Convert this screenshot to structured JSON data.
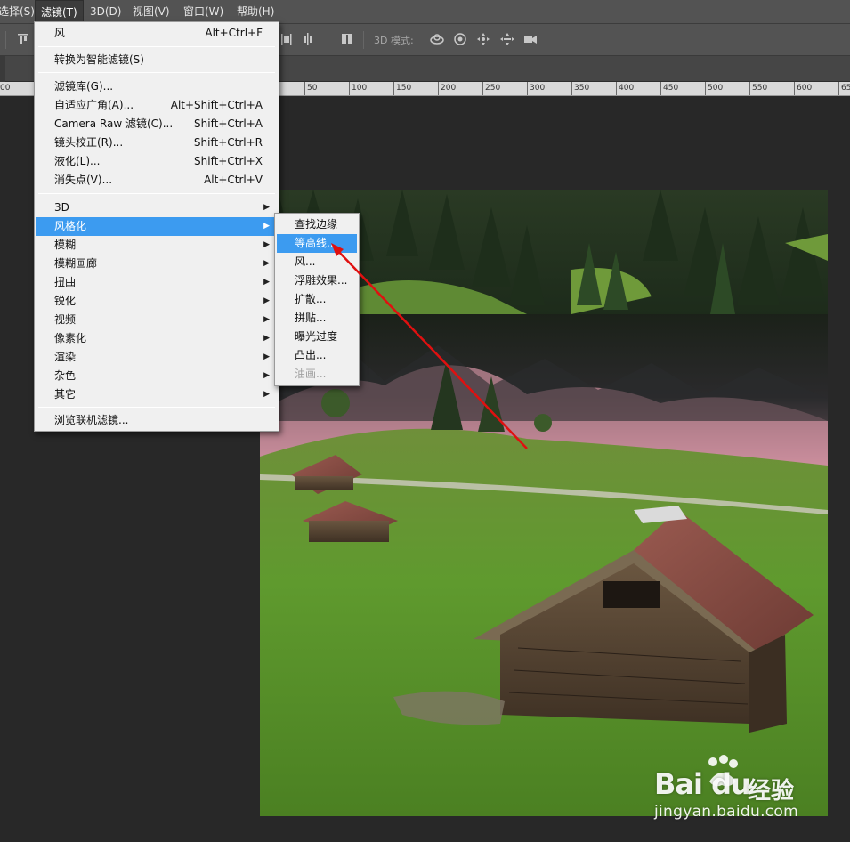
{
  "menubar": {
    "items": [
      {
        "label": "选择(S)"
      },
      {
        "label": "滤镜(T)"
      },
      {
        "label": "3D(D)"
      },
      {
        "label": "视图(V)"
      },
      {
        "label": "窗口(W)"
      },
      {
        "label": "帮助(H)"
      }
    ]
  },
  "optbar": {
    "mode3d_label": "3D 模式:"
  },
  "ruler": {
    "labels": [
      "00",
      "50",
      "100",
      "150",
      "200",
      "250",
      "300",
      "350",
      "400",
      "450",
      "500",
      "550",
      "600",
      "65"
    ]
  },
  "filter_menu": {
    "items": [
      {
        "label": "风",
        "shortcut": "Alt+Ctrl+F"
      },
      {
        "label": "转换为智能滤镜(S)"
      },
      {
        "label": "滤镜库(G)..."
      },
      {
        "label": "自适应广角(A)...",
        "shortcut": "Alt+Shift+Ctrl+A"
      },
      {
        "label": "Camera Raw 滤镜(C)...",
        "shortcut": "Shift+Ctrl+A"
      },
      {
        "label": "镜头校正(R)...",
        "shortcut": "Shift+Ctrl+R"
      },
      {
        "label": "液化(L)...",
        "shortcut": "Shift+Ctrl+X"
      },
      {
        "label": "消失点(V)...",
        "shortcut": "Alt+Ctrl+V"
      },
      {
        "label": "3D"
      },
      {
        "label": "风格化"
      },
      {
        "label": "模糊"
      },
      {
        "label": "模糊画廊"
      },
      {
        "label": "扭曲"
      },
      {
        "label": "锐化"
      },
      {
        "label": "视频"
      },
      {
        "label": "像素化"
      },
      {
        "label": "渲染"
      },
      {
        "label": "杂色"
      },
      {
        "label": "其它"
      },
      {
        "label": "浏览联机滤镜..."
      }
    ]
  },
  "stylize_submenu": {
    "items": [
      {
        "label": "查找边缘"
      },
      {
        "label": "等高线..."
      },
      {
        "label": "风..."
      },
      {
        "label": "浮雕效果..."
      },
      {
        "label": "扩散..."
      },
      {
        "label": "拼贴..."
      },
      {
        "label": "曝光过度"
      },
      {
        "label": "凸出..."
      },
      {
        "label": "油画..."
      }
    ]
  },
  "watermark": {
    "brand": "Bai du",
    "brand_cn": "经验",
    "url": "jingyan.baidu.com"
  },
  "colors": {
    "highlight": "#3c9bf0",
    "annotation_arrow": "#e01010",
    "ui_dark": "#535353",
    "canvas_bg": "#282828"
  }
}
